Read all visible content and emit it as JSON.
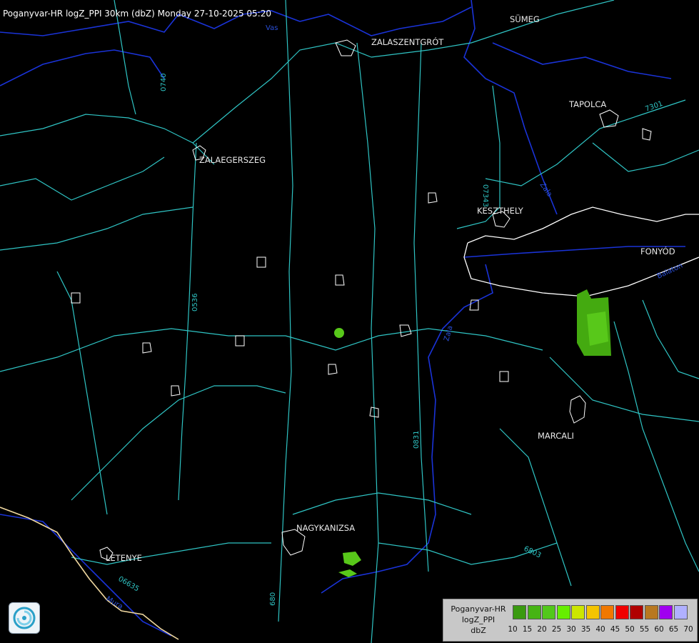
{
  "header": {
    "title": "Poganyvar-HR logZ_PPI 30km (dbZ) Monday 27-10-2025 05:20"
  },
  "towns": [
    {
      "name": "SÜMEG"
    },
    {
      "name": "ZALASZENTGRÓT"
    },
    {
      "name": "TAPOLCA"
    },
    {
      "name": "ZALAEGERSZEG"
    },
    {
      "name": "KESZTHELY"
    },
    {
      "name": "FONYÓD"
    },
    {
      "name": "MARCALI"
    },
    {
      "name": "NAGYKANIZSA"
    },
    {
      "name": "LETENYE"
    }
  ],
  "road_labels": [
    "0740",
    "07343",
    "0536",
    "0831",
    "6803",
    "06635",
    "7301",
    "680"
  ],
  "river_labels": [
    "Vas",
    "Zala",
    "Mura",
    "Balaton",
    "Zala"
  ],
  "legend": {
    "line1": "Poganyvar-HR",
    "line2": "logZ_PPI",
    "line3": "dbZ",
    "colors": [
      "#3a9a10",
      "#46b414",
      "#52c81a",
      "#66ee00",
      "#cce600",
      "#f4c400",
      "#f07800",
      "#f00000",
      "#b00000",
      "#b87820",
      "#a000f0",
      "#b0b0ff"
    ],
    "ticks": [
      "10",
      "15",
      "20",
      "25",
      "30",
      "35",
      "40",
      "45",
      "50",
      "55",
      "60",
      "65",
      "70"
    ]
  },
  "colors": {
    "road": "#2fc4c4",
    "river": "#1a33d8",
    "border": "#f0d8a0",
    "settlement": "#ffffff",
    "echo_light": "#44aa10",
    "echo_mid": "#58c81a"
  }
}
